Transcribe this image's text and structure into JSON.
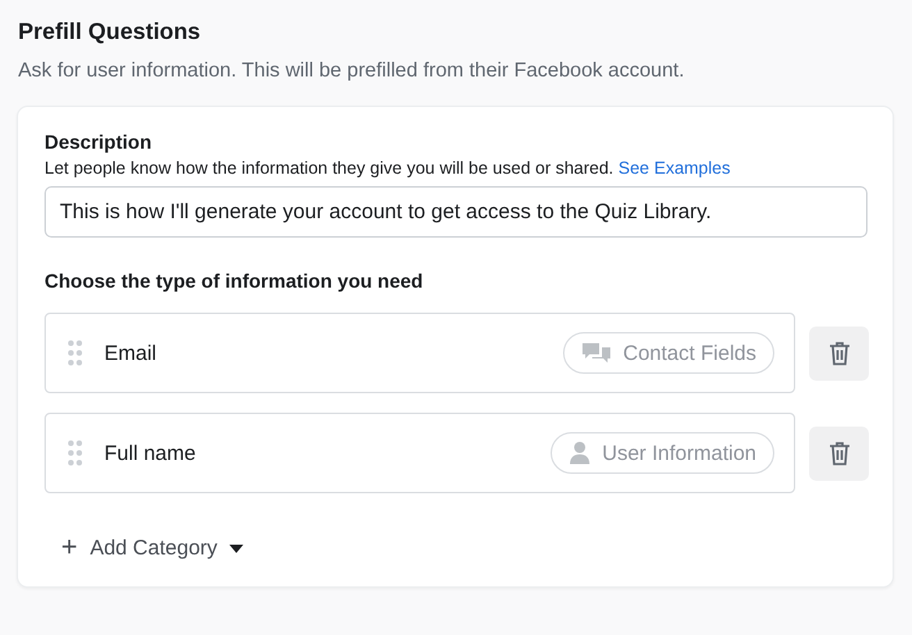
{
  "header": {
    "title": "Prefill Questions",
    "subtitle": "Ask for user information. This will be prefilled from their Facebook account."
  },
  "description": {
    "label": "Description",
    "help": "Let people know how the information they give you will be used or shared.",
    "link": "See Examples",
    "value": "This is how I'll generate your account to get access to the Quiz Library."
  },
  "questions_heading": "Choose the type of information you need",
  "questions": [
    {
      "label": "Email",
      "category": "Contact Fields",
      "kind": "contact"
    },
    {
      "label": "Full name",
      "category": "User Information",
      "kind": "user"
    }
  ],
  "add_button": {
    "icon": "+",
    "label": "Add Category"
  }
}
